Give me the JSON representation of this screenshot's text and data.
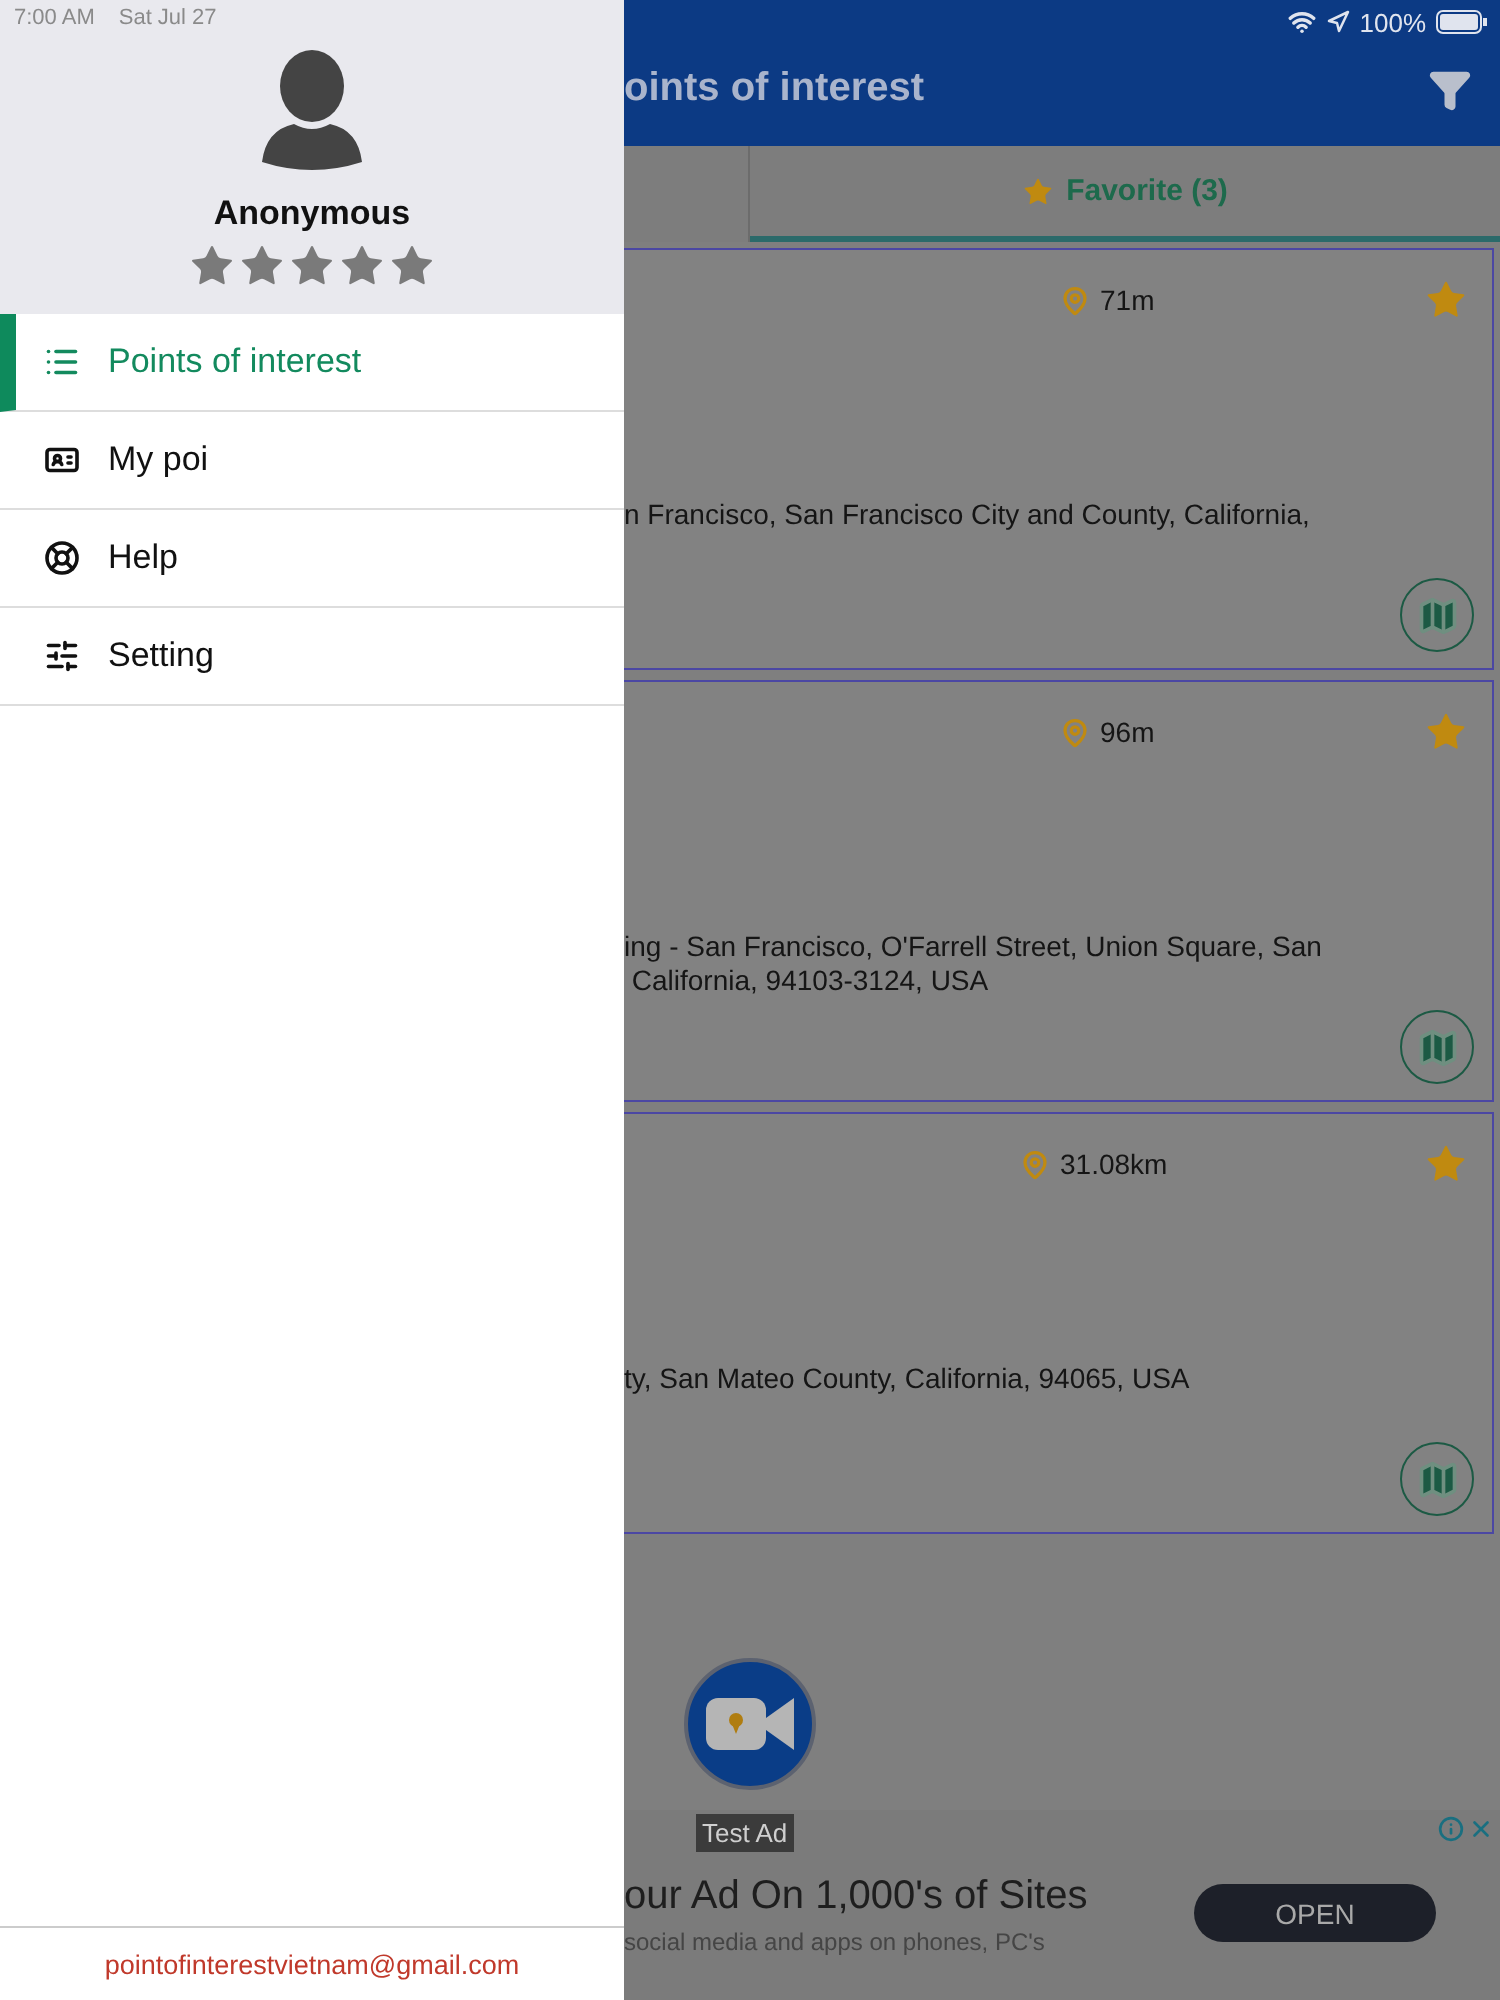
{
  "status_bar": {
    "time": "7:00 AM",
    "date": "Sat Jul 27",
    "battery": "100%"
  },
  "drawer": {
    "user": {
      "name": "Anonymous",
      "stars": 5
    },
    "menu": [
      {
        "label": "Points of interest",
        "kind": "list",
        "selected": true
      },
      {
        "label": "My poi",
        "kind": "card",
        "selected": false
      },
      {
        "label": "Help",
        "kind": "lifebuoy",
        "selected": false
      },
      {
        "label": "Setting",
        "kind": "sliders",
        "selected": false
      }
    ],
    "footer_email": "pointofinterestvietnam@gmail.com"
  },
  "app_bar": {
    "title": "oints of interest"
  },
  "tabs": [
    {
      "label": "Favorite (3)",
      "selected": true
    }
  ],
  "cards": [
    {
      "distance": "71m",
      "favorite": true,
      "address_lines": [
        "n Francisco, San Francisco City and County, California,"
      ]
    },
    {
      "distance": "96m",
      "favorite": true,
      "address_lines": [
        "ing - San Francisco, O'Farrell Street, Union Square, San",
        " California, 94103-3124, USA"
      ]
    },
    {
      "distance": "31.08km",
      "favorite": true,
      "address_lines": [
        "ty, San Mateo County, California, 94065, USA"
      ]
    }
  ],
  "video_button": {
    "label": "Test Ad"
  },
  "ad": {
    "headline": "our Ad On 1,000's of Sites",
    "body": "social media and apps on phones, PC's",
    "button": "OPEN"
  }
}
